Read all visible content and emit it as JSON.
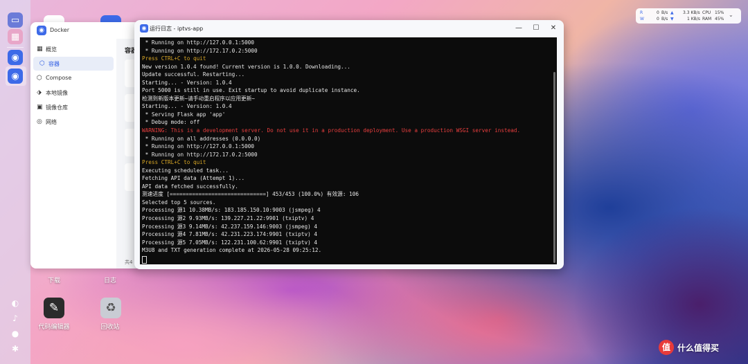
{
  "colors": {
    "terminal_bg": "#0c0c0c",
    "text_default": "#e8e8e8",
    "text_yellow": "#d7a626",
    "text_red": "#e83e3e",
    "accent": "#2d5be3"
  },
  "docker_window": {
    "title": "Docker",
    "header_partial": "容器",
    "footer_partial": "共4",
    "nav_items": [
      {
        "label": "概览",
        "icon": "dashboard-icon"
      },
      {
        "label": "容器",
        "icon": "container-icon",
        "active": true
      },
      {
        "label": "Compose",
        "icon": "compose-icon"
      },
      {
        "label": "本地镜像",
        "icon": "image-icon"
      },
      {
        "label": "镜像仓库",
        "icon": "registry-icon"
      },
      {
        "label": "网络",
        "icon": "network-icon"
      }
    ]
  },
  "log_window": {
    "title": "运行日志 - iptvs-app",
    "controls": {
      "minimize": "—",
      "maximize": "☐",
      "close": "✕"
    },
    "lines": [
      {
        "text": " * Running on http://127.0.0.1:5000",
        "color": "#e8e8e8"
      },
      {
        "text": " * Running on http://172.17.0.2:5000",
        "color": "#e8e8e8"
      },
      {
        "text": "Press CTRL+C to quit",
        "color": "#d7a626"
      },
      {
        "text": "New version 1.0.4 found! Current version is 1.0.0. Downloading...",
        "color": "#e8e8e8"
      },
      {
        "text": "Update successful. Restarting...",
        "color": "#e8e8e8"
      },
      {
        "text": "Starting... - Version: 1.0.4",
        "color": "#e8e8e8"
      },
      {
        "text": "Port 5000 is still in use. Exit startup to avoid duplicate instance.",
        "color": "#e8e8e8"
      },
      {
        "text": "检测到新版本更新~请手动重启程序以应用更新~",
        "color": "#e8e8e8"
      },
      {
        "text": "Starting... - Version: 1.0.4",
        "color": "#e8e8e8"
      },
      {
        "text": " * Serving Flask app 'app'",
        "color": "#e8e8e8"
      },
      {
        "text": " * Debug mode: off",
        "color": "#e8e8e8"
      },
      {
        "text": "WARNING: This is a development server. Do not use it in a production deployment. Use a production WSGI server instead.",
        "color": "#e83e3e"
      },
      {
        "text": " * Running on all addresses (0.0.0.0)",
        "color": "#e8e8e8"
      },
      {
        "text": " * Running on http://127.0.0.1:5000",
        "color": "#e8e8e8"
      },
      {
        "text": " * Running on http://172.17.0.2:5000",
        "color": "#e8e8e8"
      },
      {
        "text": "Press CTRL+C to quit",
        "color": "#d7a626"
      },
      {
        "text": "Executing scheduled task...",
        "color": "#e8e8e8"
      },
      {
        "text": "Fetching API data (Attempt 1)...",
        "color": "#e8e8e8"
      },
      {
        "text": "API data fetched successfully.",
        "color": "#e8e8e8"
      },
      {
        "text": "测速进度 [==============================] 453/453 (100.0%) 有效源: 106",
        "color": "#e8e8e8"
      },
      {
        "text": "Selected top 5 sources.",
        "color": "#e8e8e8"
      },
      {
        "text": "Processing 源1 10.38MB/s: 183.185.150.10:9003 (jsmpeg) 4",
        "color": "#e8e8e8"
      },
      {
        "text": "Processing 源2 9.93MB/s: 139.227.21.22:9901 (txiptv) 4",
        "color": "#e8e8e8"
      },
      {
        "text": "Processing 源3 9.14MB/s: 42.237.159.146:9003 (jsmpeg) 4",
        "color": "#e8e8e8"
      },
      {
        "text": "Processing 源4 7.81MB/s: 42.231.223.174:9901 (txiptv) 4",
        "color": "#e8e8e8"
      },
      {
        "text": "Processing 源5 7.05MB/s: 122.231.100.62:9901 (txiptv) 4",
        "color": "#e8e8e8"
      },
      {
        "text": "M3U8 and TXT generation complete at 2026-05-28 09:25:12.",
        "color": "#e8e8e8"
      }
    ]
  },
  "network_widget": {
    "up_label": "R",
    "up_value": "0",
    "up_unit": "B/s",
    "down_label": "W",
    "down_value": "0",
    "down_unit": "B/s",
    "net_up": "3.3 KB/s",
    "net_down": "1 KB/s",
    "cpu_label": "CPU",
    "cpu_value": "15%",
    "ram_label": "RAM",
    "ram_value": "45%"
  },
  "desktop": {
    "icons": [
      {
        "label": "下载"
      },
      {
        "label": "日志"
      },
      {
        "label": "代码编辑器",
        "icon": "code-editor-icon"
      },
      {
        "label": "回收站",
        "icon": "recycle-bin-icon"
      }
    ]
  },
  "watermark": {
    "logo": "值",
    "text": "什么值得买"
  }
}
